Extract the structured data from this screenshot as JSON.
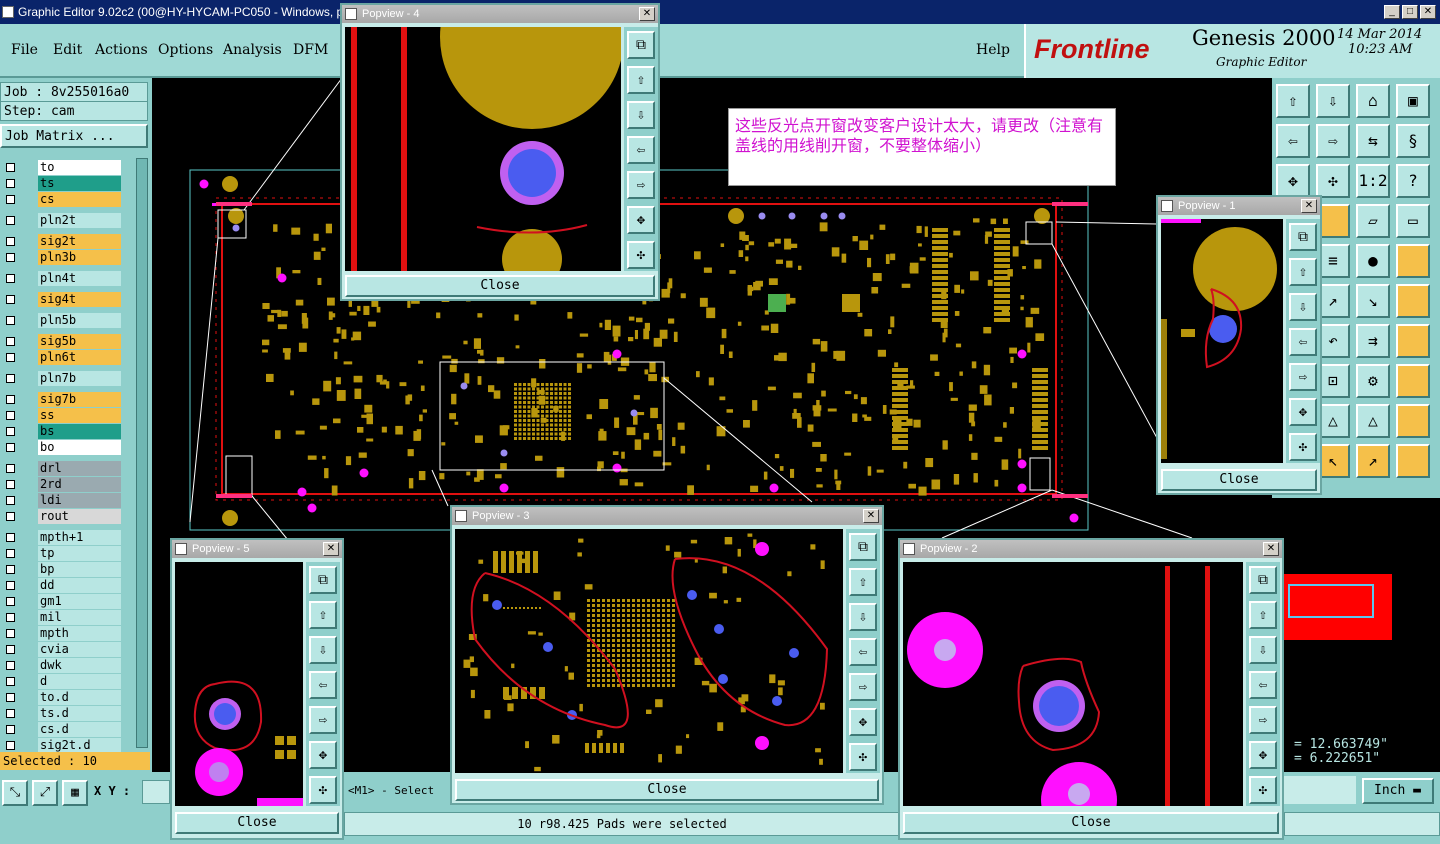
{
  "window": {
    "title": "Graphic Editor 9.02c2 (00@HY-HYCAM-PC050 - Windows, p",
    "min": "_",
    "max": "□",
    "close": "✕"
  },
  "menu": {
    "file": "File",
    "edit": "Edit",
    "actions": "Actions",
    "options": "Options",
    "analysis": "Analysis",
    "dfm": "DFM",
    "help": "Help"
  },
  "logo": {
    "brand": "Frontline",
    "product": "Genesis 2000",
    "subtitle": "Graphic Editor",
    "date": "14 Mar 2014",
    "time": "10:23 AM"
  },
  "job": {
    "job_line": "Job : 8v255016a0",
    "step_line": "Step: cam",
    "matrix_button": "Job Matrix ..."
  },
  "layers": [
    {
      "name": "to",
      "color": "#ffffff"
    },
    {
      "name": "ts",
      "color": "#1f9e8a"
    },
    {
      "name": "cs",
      "color": "#f5c04a"
    },
    {
      "name": "pln2t",
      "color": "#b8e6e3"
    },
    {
      "name": "sig2t",
      "color": "#f5c04a"
    },
    {
      "name": "pln3b",
      "color": "#f5c04a"
    },
    {
      "name": "pln4t",
      "color": "#b8e6e3"
    },
    {
      "name": "sig4t",
      "color": "#f5c04a"
    },
    {
      "name": "pln5b",
      "color": "#b8e6e3"
    },
    {
      "name": "sig5b",
      "color": "#f5c04a"
    },
    {
      "name": "pln6t",
      "color": "#f5c04a"
    },
    {
      "name": "pln7b",
      "color": "#b8e6e3"
    },
    {
      "name": "sig7b",
      "color": "#f5c04a"
    },
    {
      "name": "ss",
      "color": "#f5c04a"
    },
    {
      "name": "bs",
      "color": "#1f9e8a"
    },
    {
      "name": "bo",
      "color": "#ffffff"
    },
    {
      "name": "drl",
      "color": "#9aaab0"
    },
    {
      "name": "2rd",
      "color": "#9aaab0"
    },
    {
      "name": "ldi",
      "color": "#9aaab0"
    },
    {
      "name": "rout",
      "color": "#d8d8d8"
    },
    {
      "name": "mpth+1",
      "color": "#b8e6e3"
    },
    {
      "name": "tp",
      "color": "#b8e6e3"
    },
    {
      "name": "bp",
      "color": "#b8e6e3"
    },
    {
      "name": "dd",
      "color": "#b8e6e3"
    },
    {
      "name": "gm1",
      "color": "#b8e6e3"
    },
    {
      "name": "mil",
      "color": "#b8e6e3"
    },
    {
      "name": "mpth",
      "color": "#b8e6e3"
    },
    {
      "name": "cvia",
      "color": "#b8e6e3"
    },
    {
      "name": "dwk",
      "color": "#b8e6e3"
    },
    {
      "name": "d",
      "color": "#b8e6e3"
    },
    {
      "name": "to.d",
      "color": "#b8e6e3"
    },
    {
      "name": "ts.d",
      "color": "#b8e6e3"
    },
    {
      "name": "cs.d",
      "color": "#b8e6e3"
    },
    {
      "name": "sig2t.d",
      "color": "#b8e6e3"
    }
  ],
  "selected_count": "Selected : 10",
  "xy_label": "X Y :",
  "mouse_hint": "<M1> - Select",
  "status_message": "10 r98.425 Pads were selected",
  "coords": {
    "x": "= 12.663749\"",
    "y": "= 6.222651\""
  },
  "units": "Inch",
  "note_text": "这些反光点开窗改变客户设计太大，请更改（注意有盖线的用线削开窗，不要整体缩小）",
  "popviews": {
    "p1": {
      "title": "Popview - 1",
      "close": "Close"
    },
    "p2": {
      "title": "Popview - 2",
      "close": "Close"
    },
    "p3": {
      "title": "Popview - 3",
      "close": "Close"
    },
    "p4": {
      "title": "Popview - 4",
      "close": "Close"
    },
    "p5": {
      "title": "Popview - 5",
      "close": "Close"
    }
  },
  "colors": {
    "pad": "#b8960c",
    "trace": "#e01010",
    "via_blue": "#4a5cf0",
    "via_magenta": "#ff10ff",
    "markup": "#d01020"
  }
}
